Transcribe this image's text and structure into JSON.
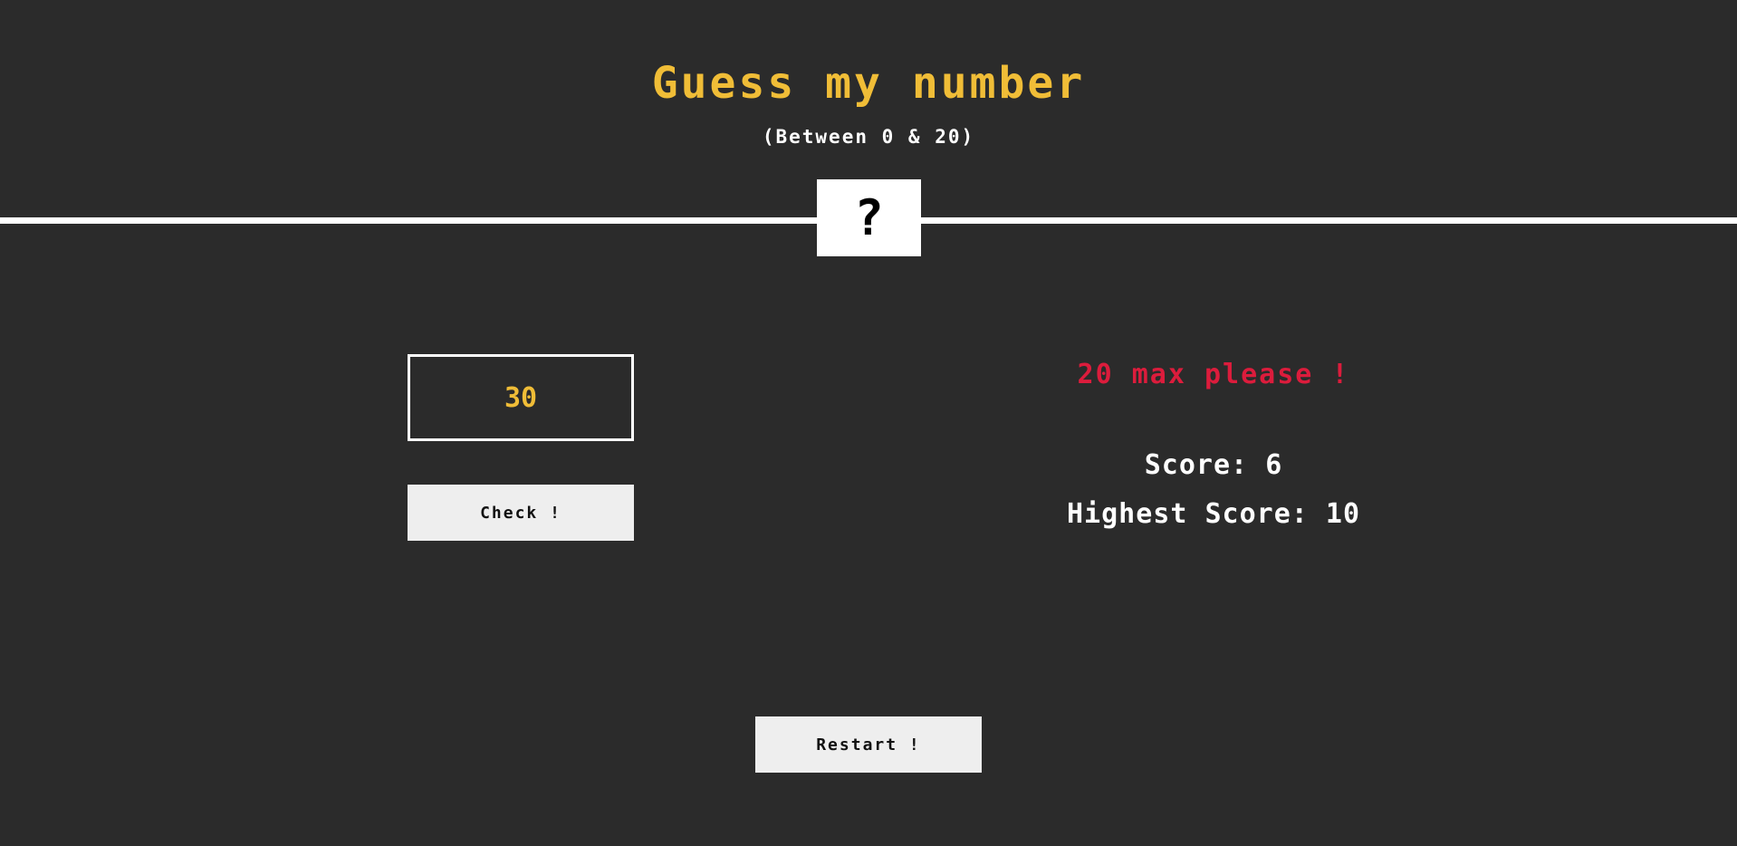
{
  "header": {
    "title": "Guess my number",
    "subtitle": "(Between 0 & 20)"
  },
  "secret": {
    "display": "?"
  },
  "guess": {
    "value": "30"
  },
  "buttons": {
    "check_label": "Check !",
    "restart_label": "Restart !"
  },
  "status": {
    "message": "20 max please !",
    "score_label": "Score:",
    "score_value": "6",
    "highscore_label": "Highest Score:",
    "highscore_value": "10"
  },
  "colors": {
    "background": "#2b2b2b",
    "title": "#f0bd37",
    "message": "#dc1c3c",
    "text": "#ffffff",
    "button_bg": "#eeeeee"
  }
}
